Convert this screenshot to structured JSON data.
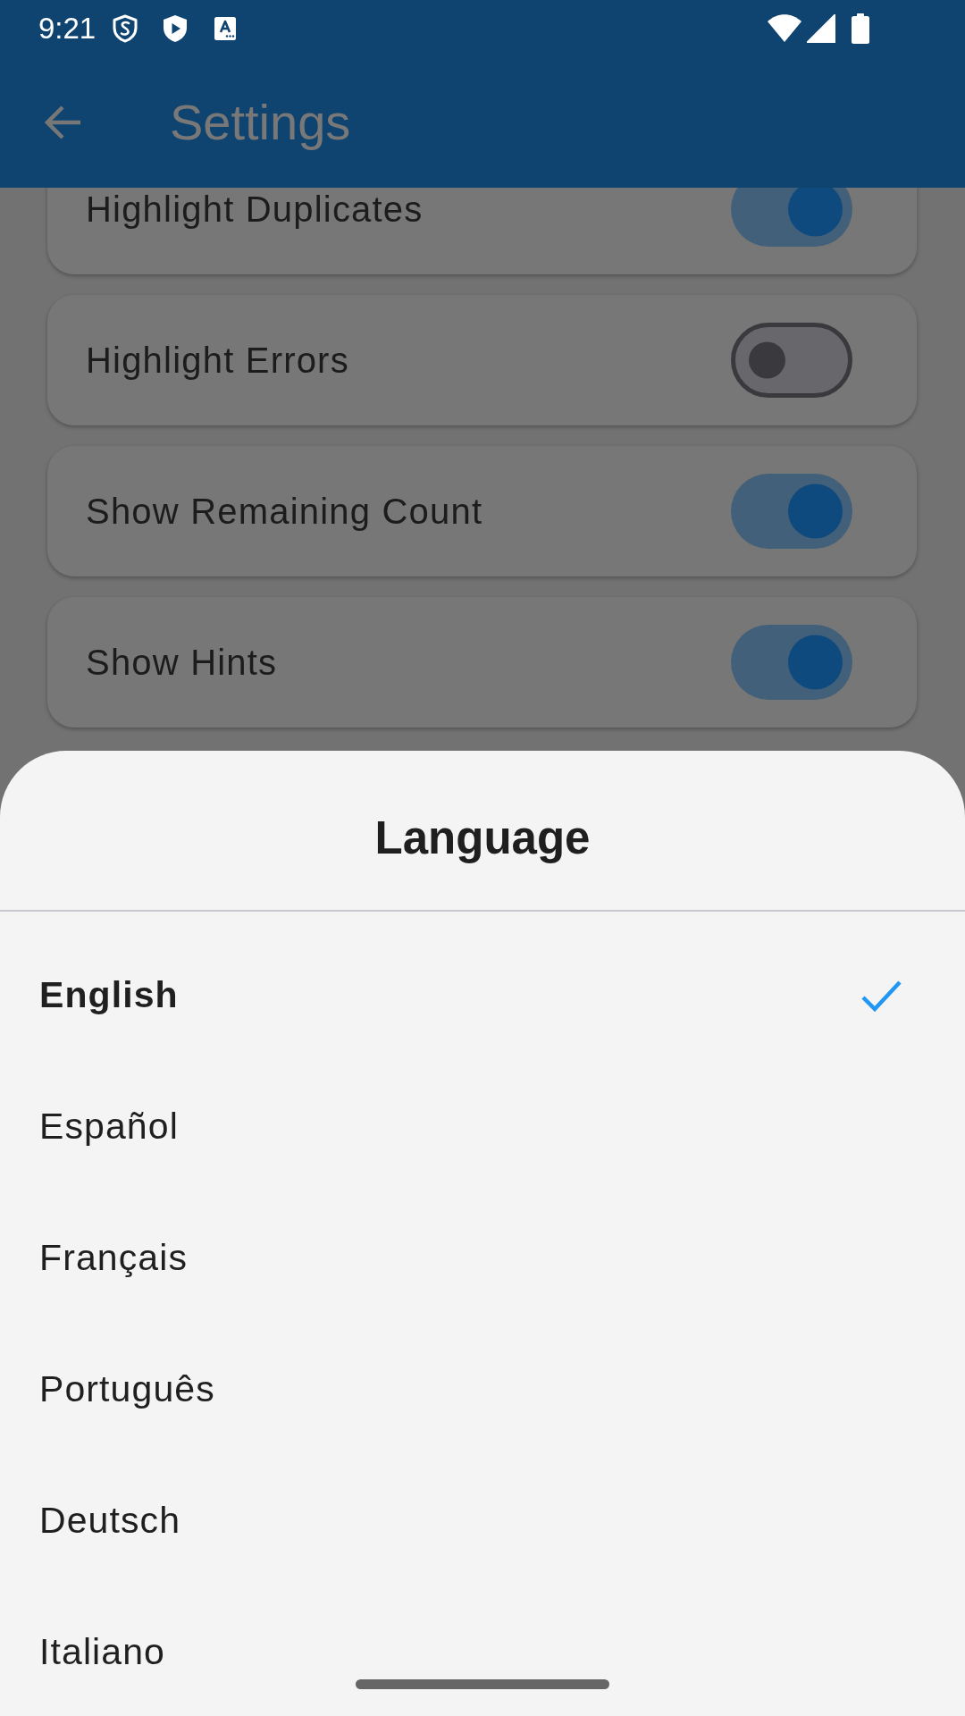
{
  "status_bar": {
    "time": "9:21"
  },
  "app_bar": {
    "title": "Settings"
  },
  "settings": [
    {
      "label": "Highlight Duplicates",
      "on": true
    },
    {
      "label": "Highlight Errors",
      "on": false
    },
    {
      "label": "Show Remaining Count",
      "on": true
    },
    {
      "label": "Show Hints",
      "on": true
    }
  ],
  "language_sheet": {
    "title": "Language",
    "options": [
      {
        "label": "English",
        "selected": true
      },
      {
        "label": "Español",
        "selected": false
      },
      {
        "label": "Français",
        "selected": false
      },
      {
        "label": "Português",
        "selected": false
      },
      {
        "label": "Deutsch",
        "selected": false
      },
      {
        "label": "Italiano",
        "selected": false
      }
    ]
  }
}
